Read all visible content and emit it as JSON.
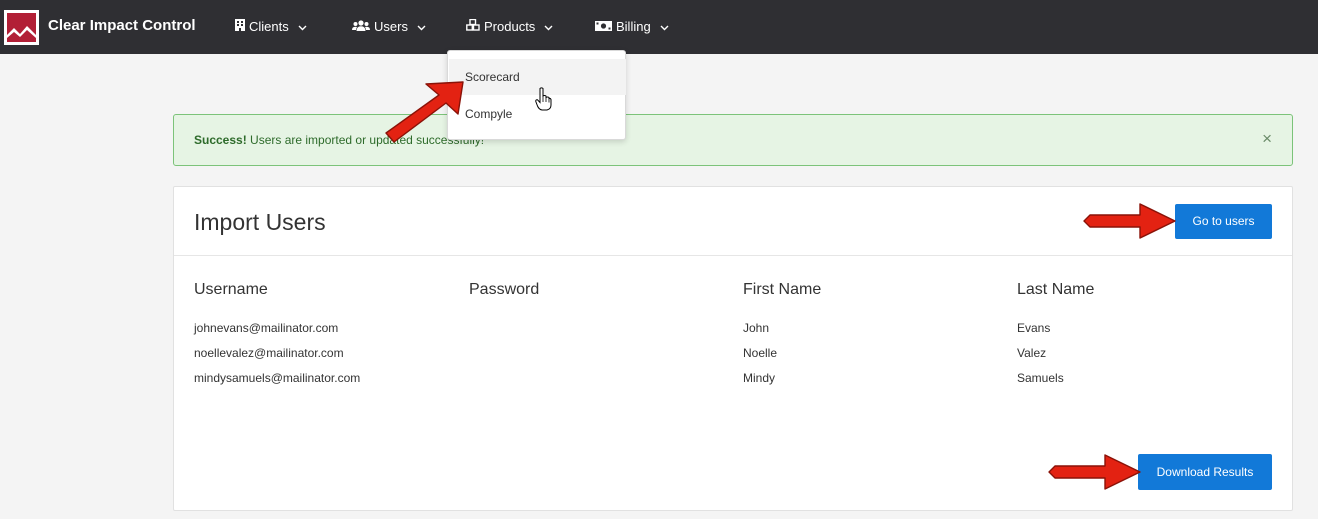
{
  "navbar": {
    "brand": "Clear Impact Control",
    "items": [
      {
        "label": "Clients",
        "icon": "building-icon"
      },
      {
        "label": "Users",
        "icon": "users-icon"
      },
      {
        "label": "Products",
        "icon": "cubes-icon"
      },
      {
        "label": "Billing",
        "icon": "money-bill-icon"
      }
    ]
  },
  "products_dropdown": {
    "items": [
      {
        "label": "Scorecard",
        "hovered": true
      },
      {
        "label": "Compyle",
        "hovered": false
      }
    ]
  },
  "alert": {
    "strong": "Success!",
    "message": " Users are imported or updated successfully!",
    "close": "×"
  },
  "card": {
    "title": "Import Users",
    "go_button": "Go to users",
    "download_button": "Download Results",
    "columns": [
      "Username",
      "Password",
      "First Name",
      "Last Name"
    ],
    "rows": [
      {
        "username": "johnevans@mailinator.com",
        "password": "",
        "first": "John",
        "last": "Evans"
      },
      {
        "username": "noellevalez@mailinator.com",
        "password": "",
        "first": "Noelle",
        "last": "Valez"
      },
      {
        "username": "mindysamuels@mailinator.com",
        "password": "",
        "first": "Mindy",
        "last": "Samuels"
      }
    ]
  },
  "colors": {
    "navbar": "#2f2f33",
    "primary": "#1279d8",
    "success_bg": "#e6f4e4",
    "success_border": "#7cc379",
    "logo_red": "#b21f36",
    "arrow_red": "#e32212"
  }
}
